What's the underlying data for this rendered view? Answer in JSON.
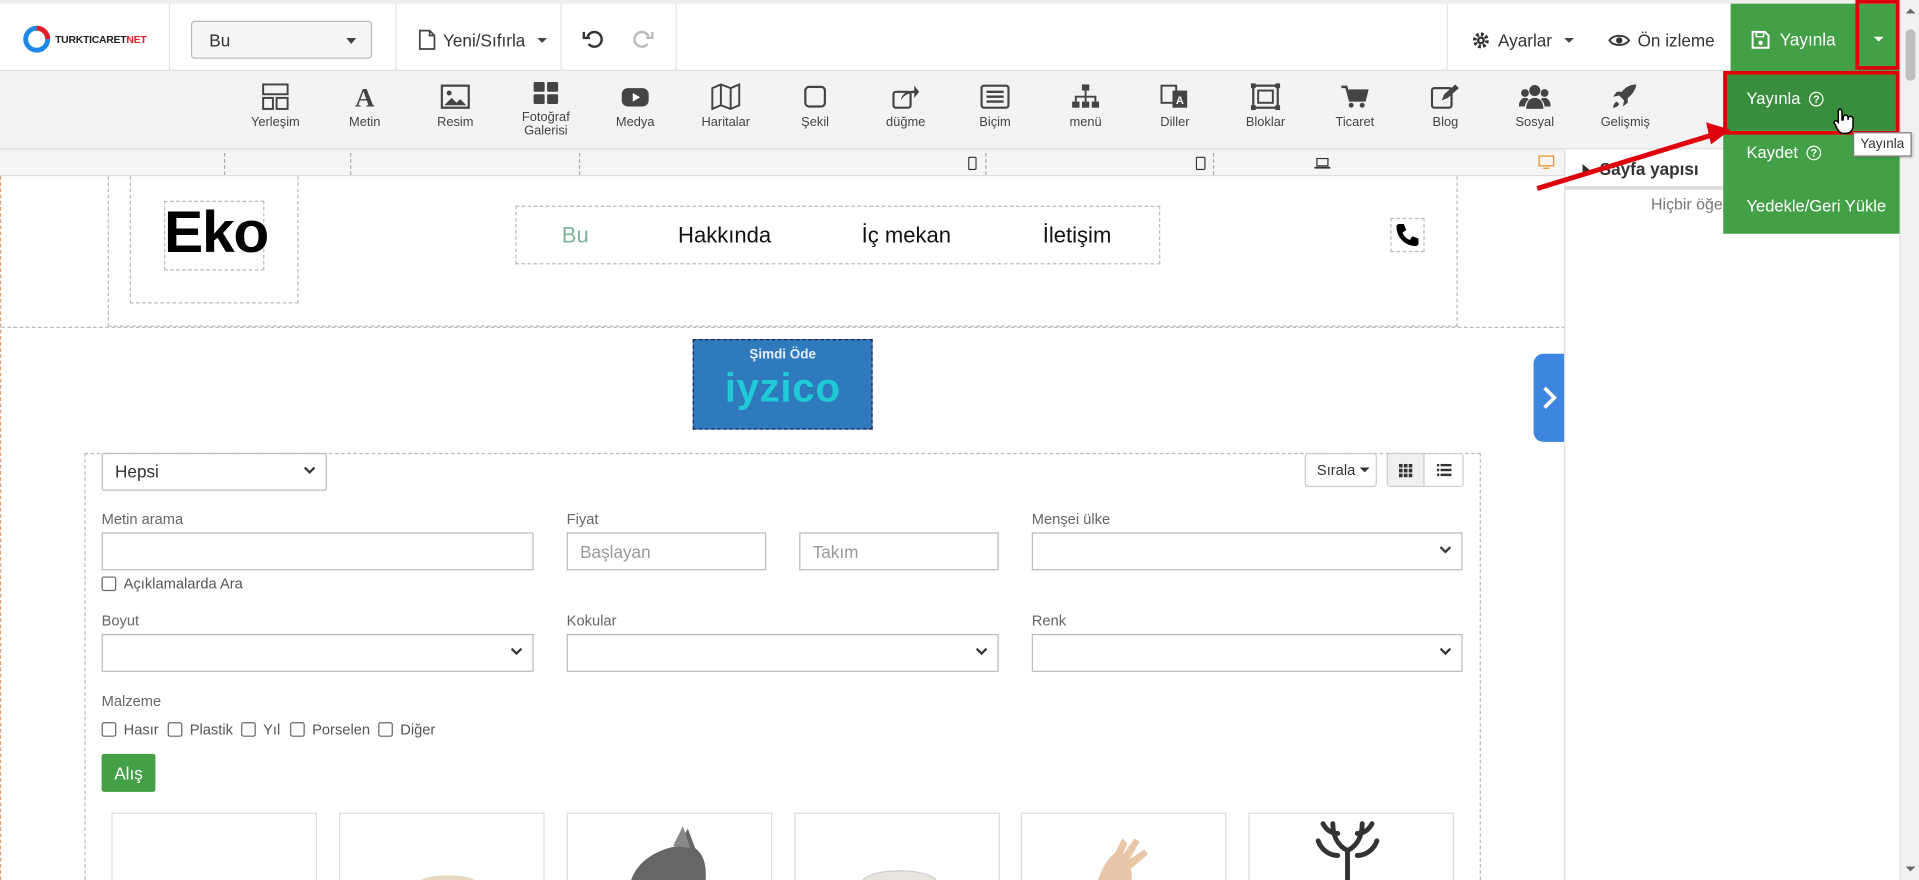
{
  "brand": {
    "logo_text_dark": "TURKTICARET",
    "logo_text_red": "NET"
  },
  "topbar": {
    "page_select": "Bu",
    "new_reset": "Yeni/Sıfırla",
    "settings": "Ayarlar",
    "preview": "Ön izleme",
    "publish": "Yayınla"
  },
  "toolbar": {
    "items": [
      {
        "label": "Yerleşim",
        "icon": "layout-icon"
      },
      {
        "label": "Metin",
        "icon": "text-icon"
      },
      {
        "label": "Resim",
        "icon": "image-icon"
      },
      {
        "label": "Fotoğraf Galerisi",
        "icon": "gallery-icon"
      },
      {
        "label": "Medya",
        "icon": "youtube-icon"
      },
      {
        "label": "Haritalar",
        "icon": "map-icon"
      },
      {
        "label": "Şekil",
        "icon": "shape-icon"
      },
      {
        "label": "düğme",
        "icon": "share-icon"
      },
      {
        "label": "Biçim",
        "icon": "form-icon"
      },
      {
        "label": "menü",
        "icon": "sitemap-icon"
      },
      {
        "label": "Diller",
        "icon": "language-icon"
      },
      {
        "label": "Bloklar",
        "icon": "blocks-icon"
      },
      {
        "label": "Ticaret",
        "icon": "cart-icon"
      },
      {
        "label": "Blog",
        "icon": "edit-icon"
      },
      {
        "label": "Sosyal",
        "icon": "users-icon"
      },
      {
        "label": "Gelişmiş",
        "icon": "rocket-icon"
      }
    ]
  },
  "site": {
    "logo": "Eko",
    "nav": [
      "Bu",
      "Hakkında",
      "İç mekan",
      "İletişim"
    ],
    "payment": {
      "label": "Şimdi Öde",
      "brand": "iyzico"
    }
  },
  "filters": {
    "category": "Hepsi",
    "sort": "Sırala",
    "text_search_label": "Metin arama",
    "search_descriptions": "Açıklamalarda Ara",
    "price_label": "Fiyat",
    "price_from_placeholder": "Başlayan",
    "price_to_placeholder": "Takım",
    "origin_label": "Menşei ülke",
    "size_label": "Boyut",
    "scents_label": "Kokular",
    "color_label": "Renk",
    "material_label": "Malzeme",
    "materials": [
      "Hasır",
      "Plastik",
      "Yıl",
      "Porselen",
      "Diğer"
    ],
    "buy_button": "Alış"
  },
  "right_panel": {
    "title": "Sayfa yapısı",
    "empty": "Hiçbir öğe"
  },
  "publish_menu": {
    "items": [
      "Yayınla",
      "Kaydet",
      "Yedekle/Geri Yükle"
    ],
    "tooltip": "Yayınla"
  },
  "colors": {
    "accent_green": "#43a047",
    "highlight_red": "#e0000b",
    "nav_active": "#7fb39a"
  }
}
